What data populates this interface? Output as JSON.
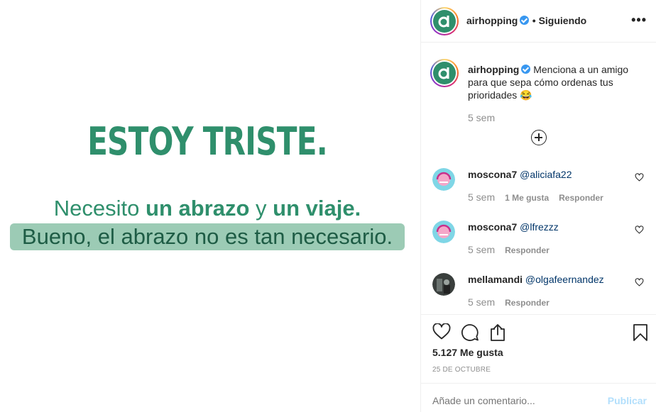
{
  "post_image": {
    "title": "ESTOY TRISTE.",
    "line1_a": "Necesito ",
    "line1_b": "un abrazo",
    "line1_c": " y ",
    "line1_d": "un viaje.",
    "line2": "Bueno, el abrazo no es tan necesario."
  },
  "header": {
    "username": "airhopping",
    "follow_status": "• Siguiendo",
    "more_label": "•••"
  },
  "caption": {
    "username": "airhopping",
    "text": "Menciona a un amigo para que sepa cómo ordenas tus prioridades 😂",
    "time": "5 sem"
  },
  "comments": [
    {
      "username": "moscona7",
      "mention": "@aliciafa22",
      "time": "5 sem",
      "likes": "1 Me gusta",
      "reply": "Responder"
    },
    {
      "username": "moscona7",
      "mention": "@lfrezzz",
      "time": "5 sem",
      "reply": "Responder"
    },
    {
      "username": "mellamandi",
      "mention": "@olgafeernandez",
      "time": "5 sem",
      "reply": "Responder"
    }
  ],
  "footer": {
    "likes": "5.127 Me gusta",
    "date": "25 DE OCTUBRE",
    "comment_placeholder": "Añade un comentario...",
    "publish": "Publicar"
  },
  "colors": {
    "brand": "#2f8f6c",
    "highlight": "#9ccbb5",
    "verified": "#3897f0"
  }
}
